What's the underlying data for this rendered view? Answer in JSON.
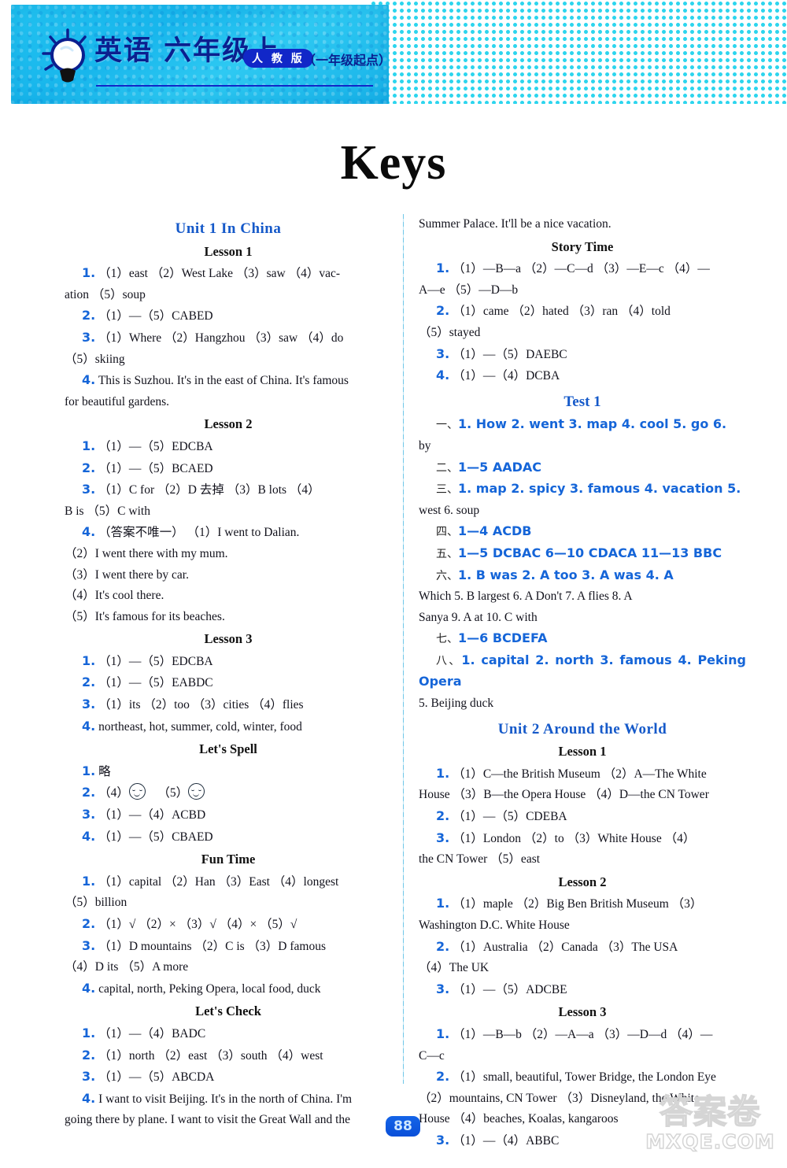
{
  "header": {
    "subject": "英语  六年级上",
    "badge": "人 教 版",
    "sub": "（一年级起点）",
    "bulb_icon": "lightbulb-icon"
  },
  "page_title": "Keys",
  "footer": {
    "page_number": "88",
    "watermark_cn": "答案卷",
    "watermark_url": "MXQE.COM"
  },
  "left_column": {
    "blocks": [
      {
        "kind": "unit",
        "text": "Unit 1   In China"
      },
      {
        "kind": "sec",
        "text": "Lesson 1"
      },
      {
        "kind": "item",
        "num": "1.",
        "text": "（1）east   （2）West Lake   （3）saw   （4）vac-"
      },
      {
        "kind": "cont",
        "text": "ation   （5）soup"
      },
      {
        "kind": "item",
        "num": "2.",
        "text": "（1）—（5）CABED"
      },
      {
        "kind": "item",
        "num": "3.",
        "text": "（1）Where   （2）Hangzhou   （3）saw   （4）do"
      },
      {
        "kind": "cont",
        "text": "（5）skiing"
      },
      {
        "kind": "item",
        "num": "4.",
        "text": "This is Suzhou. It's in the east of China. It's famous"
      },
      {
        "kind": "cont",
        "text": "for beautiful gardens."
      },
      {
        "kind": "sec",
        "text": "Lesson 2"
      },
      {
        "kind": "item",
        "num": "1.",
        "text": "（1）—（5）EDCBA"
      },
      {
        "kind": "item",
        "num": "2.",
        "text": "（1）—（5）BCAED"
      },
      {
        "kind": "item",
        "num": "3.",
        "text": "（1）C   for   （2）D   去掉   （3）B   lots   （4）"
      },
      {
        "kind": "cont",
        "text": "B   is   （5）C   with"
      },
      {
        "kind": "item",
        "num": "4.",
        "text": "（答案不唯一）   （1）I went to Dalian."
      },
      {
        "kind": "cont",
        "text": "（2）I went there with my mum."
      },
      {
        "kind": "cont",
        "text": "（3）I went there by car."
      },
      {
        "kind": "cont",
        "text": "（4）It's cool there."
      },
      {
        "kind": "cont",
        "text": "（5）It's famous for its beaches."
      },
      {
        "kind": "sec",
        "text": "Lesson 3"
      },
      {
        "kind": "item",
        "num": "1.",
        "text": "（1）—（5）EDCBA"
      },
      {
        "kind": "item",
        "num": "2.",
        "text": "（1）—（5）EABDC"
      },
      {
        "kind": "item",
        "num": "3.",
        "text": "（1）its   （2）too   （3）cities   （4）flies"
      },
      {
        "kind": "item",
        "num": "4.",
        "text": "northeast, hot, summer, cold, winter, food"
      },
      {
        "kind": "sec",
        "text": "Let's Spell"
      },
      {
        "kind": "item",
        "num": "1.",
        "text": "略"
      },
      {
        "kind": "smiley",
        "num": "2.",
        "pre": "（4）",
        "mid": "（5）"
      },
      {
        "kind": "item",
        "num": "3.",
        "text": "（1）—（4）ACBD"
      },
      {
        "kind": "item",
        "num": "4.",
        "text": "（1）—（5）CBAED"
      },
      {
        "kind": "sec",
        "text": "Fun Time"
      },
      {
        "kind": "item",
        "num": "1.",
        "text": "（1）capital   （2）Han   （3）East   （4）longest"
      },
      {
        "kind": "cont",
        "text": "（5）billion"
      },
      {
        "kind": "item",
        "num": "2.",
        "text": "（1）√   （2）×   （3）√   （4）×   （5）√"
      },
      {
        "kind": "item",
        "num": "3.",
        "text": "（1）D   mountains   （2）C   is   （3）D   famous"
      },
      {
        "kind": "cont",
        "text": "（4）D   its   （5）A   more"
      },
      {
        "kind": "item",
        "num": "4.",
        "text": "capital, north, Peking Opera, local food, duck"
      },
      {
        "kind": "sec",
        "text": "Let's Check"
      },
      {
        "kind": "item",
        "num": "1.",
        "text": "（1）—（4）BADC"
      },
      {
        "kind": "item",
        "num": "2.",
        "text": "（1）north   （2）east   （3）south   （4）west"
      },
      {
        "kind": "item",
        "num": "3.",
        "text": "（1）—（5）ABCDA"
      },
      {
        "kind": "item",
        "num": "4.",
        "text": "I want to visit Beijing. It's in the north of China. I'm"
      },
      {
        "kind": "cont",
        "text": "going there by plane. I want to visit the Great Wall and the"
      }
    ]
  },
  "right_column": {
    "blocks": [
      {
        "kind": "cont",
        "text": "Summer Palace. It'll be a nice vacation."
      },
      {
        "kind": "sec",
        "text": "Story Time"
      },
      {
        "kind": "item",
        "num": "1.",
        "text": "（1）—B—a   （2）—C—d   （3）—E—c   （4）—"
      },
      {
        "kind": "cont",
        "text": "A—e   （5）—D—b"
      },
      {
        "kind": "item",
        "num": "2.",
        "text": "（1）came   （2）hated   （3）ran   （4）told"
      },
      {
        "kind": "cont",
        "text": "（5）stayed"
      },
      {
        "kind": "item",
        "num": "3.",
        "text": "（1）—（5）DAEBC"
      },
      {
        "kind": "item",
        "num": "4.",
        "text": "（1）—（4）DCBA"
      },
      {
        "kind": "test",
        "text": "Test 1"
      },
      {
        "kind": "test_item",
        "cn": "一、",
        "text": "1. How   2. went   3. map   4. cool   5. go   6."
      },
      {
        "kind": "cont",
        "text": "by"
      },
      {
        "kind": "test_item",
        "cn": "二、",
        "text": "1—5 AADAC"
      },
      {
        "kind": "test_item",
        "cn": "三、",
        "text": "1. map   2. spicy   3. famous   4. vacation   5."
      },
      {
        "kind": "cont",
        "text": "west   6. soup"
      },
      {
        "kind": "test_item",
        "cn": "四、",
        "text": "1—4 ACDB"
      },
      {
        "kind": "test_item",
        "cn": "五、",
        "text": "1—5 DCBAC   6—10 CDACA   11—13 BBC"
      },
      {
        "kind": "test_item",
        "cn": "六、",
        "text": "1. B   was   2. A   too   3. A   was   4. A"
      },
      {
        "kind": "cont",
        "text": "Which   5. B   largest   6. A   Don't   7. A   flies   8. A"
      },
      {
        "kind": "cont",
        "text": "Sanya   9. A   at   10. C   with"
      },
      {
        "kind": "test_item",
        "cn": "七、",
        "text": "1—6 BCDEFA"
      },
      {
        "kind": "test_item",
        "cn": "八、",
        "text": "1. capital   2. north   3. famous   4. Peking Opera"
      },
      {
        "kind": "cont",
        "text": "5. Beijing duck"
      },
      {
        "kind": "unit",
        "text": "Unit 2   Around the World"
      },
      {
        "kind": "sec",
        "text": "Lesson 1"
      },
      {
        "kind": "item",
        "num": "1.",
        "text": "（1）C—the British Museum   （2）A—The White"
      },
      {
        "kind": "cont",
        "text": "House   （3）B—the Opera House   （4）D—the CN Tower"
      },
      {
        "kind": "item",
        "num": "2.",
        "text": "（1）—（5）CDEBA"
      },
      {
        "kind": "item",
        "num": "3.",
        "text": "（1）London   （2）to   （3）White House   （4）"
      },
      {
        "kind": "cont",
        "text": "the CN Tower   （5）east"
      },
      {
        "kind": "sec",
        "text": "Lesson 2"
      },
      {
        "kind": "item",
        "num": "1.",
        "text": "（1）maple   （2）Big Ben  British Museum   （3）"
      },
      {
        "kind": "cont",
        "text": "Washington D.C.  White House"
      },
      {
        "kind": "item",
        "num": "2.",
        "text": "（1）Australia   （2）Canada   （3）The USA"
      },
      {
        "kind": "cont",
        "text": "（4）The UK"
      },
      {
        "kind": "item",
        "num": "3.",
        "text": "（1）—（5）ADCBE"
      },
      {
        "kind": "sec",
        "text": "Lesson 3"
      },
      {
        "kind": "item",
        "num": "1.",
        "text": "（1）—B—b   （2）—A—a   （3）—D—d   （4）—"
      },
      {
        "kind": "cont",
        "text": "C—c"
      },
      {
        "kind": "item",
        "num": "2.",
        "text": "（1）small, beautiful, Tower Bridge, the London Eye"
      },
      {
        "kind": "cont",
        "text": "（2）mountains, CN Tower   （3）Disneyland, the White"
      },
      {
        "kind": "cont",
        "text": "House   （4）beaches, Koalas, kangaroos"
      },
      {
        "kind": "item",
        "num": "3.",
        "text": "（1）—（4）ABBC"
      }
    ]
  }
}
